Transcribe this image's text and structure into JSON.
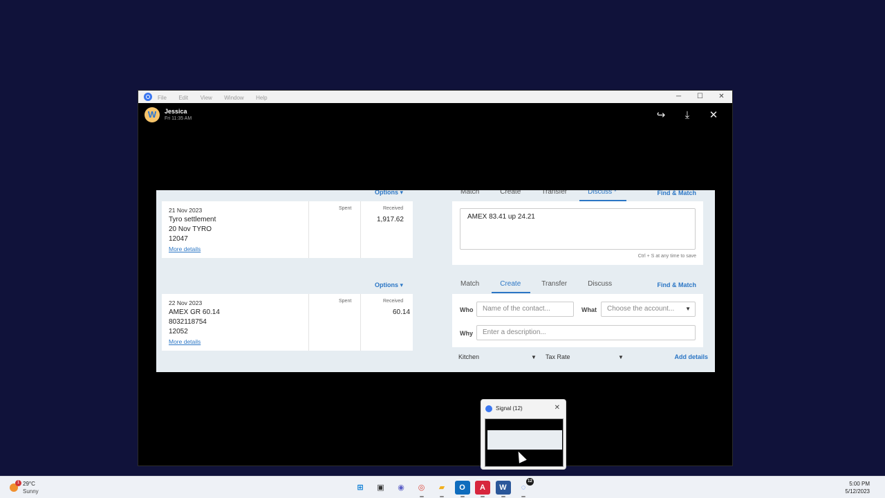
{
  "window": {
    "menu": [
      "File",
      "Edit",
      "View",
      "Window",
      "Help"
    ],
    "controls": {
      "minimize": "─",
      "maximize": "☐",
      "close": "✕"
    }
  },
  "viewer": {
    "avatar_glyph": "W",
    "sender": "Jessica",
    "time": "Fri 11:35 AM",
    "actions": {
      "share": "↪",
      "download": "⤓",
      "close": "✕"
    }
  },
  "reconcile": {
    "top": {
      "options_label": "Options ▾",
      "tabs": [
        "Match",
        "Create",
        "Transfer",
        "Discuss *"
      ],
      "active_tab": "Discuss *",
      "find_match": "Find & Match",
      "statement": {
        "date": "21 Nov 2023",
        "line1": "Tyro settlement",
        "line2": "20 Nov TYRO",
        "line3": "12047",
        "more": "More details",
        "spent_label": "Spent",
        "received_label": "Received",
        "received": "1,917.62"
      },
      "discuss_text": "AMEX 83.41 up 24.21",
      "save_hint": "Ctrl + S at any time to save"
    },
    "bottom": {
      "options_label": "Options ▾",
      "tabs": [
        "Match",
        "Create",
        "Transfer",
        "Discuss"
      ],
      "active_tab": "Create",
      "find_match": "Find & Match",
      "statement": {
        "date": "22 Nov 2023",
        "line1": "AMEX GR 60.14",
        "line2": "8032118754",
        "line3": "12052",
        "more": "More details",
        "spent_label": "Spent",
        "received_label": "Received",
        "received": "60.14"
      },
      "who_label": "Who",
      "who_placeholder": "Name of the contact...",
      "what_label": "What",
      "what_placeholder": "Choose the account...",
      "why_label": "Why",
      "why_placeholder": "Enter a description...",
      "tracking": "Kitchen",
      "tax": "Tax Rate",
      "add_details": "Add details"
    }
  },
  "preview": {
    "title": "Signal (12)",
    "close": "✕"
  },
  "taskbar": {
    "weather": {
      "temp": "29°C",
      "condition": "Sunny",
      "badge": "1"
    },
    "apps": [
      {
        "name": "windows-start",
        "glyph": "⊞",
        "color": "#0078d4"
      },
      {
        "name": "task-view",
        "glyph": "▣",
        "color": "#333333"
      },
      {
        "name": "teams-chat",
        "glyph": "◉",
        "color": "#5b5fc7"
      },
      {
        "name": "chrome",
        "glyph": "◎",
        "color": "#db4437"
      },
      {
        "name": "file-explorer",
        "glyph": "▰",
        "color": "#f2b01e"
      },
      {
        "name": "outlook",
        "glyph": "O",
        "color": "#0f6cbd"
      },
      {
        "name": "acrobat",
        "glyph": "A",
        "color": "#d7263d"
      },
      {
        "name": "word",
        "glyph": "W",
        "color": "#2b579a"
      },
      {
        "name": "signal",
        "glyph": "◌",
        "color": "#3a76f0",
        "badge": "12"
      }
    ],
    "time": "5:00 PM",
    "date": "5/12/2023"
  }
}
